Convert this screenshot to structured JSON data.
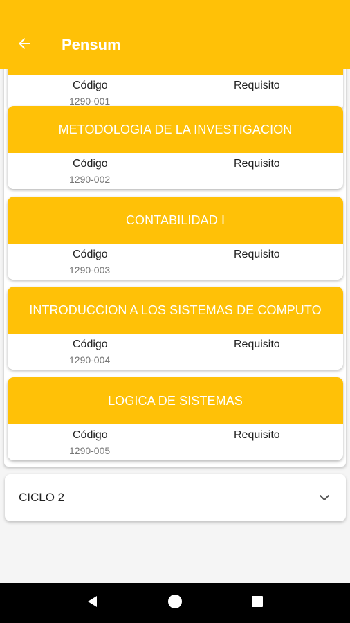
{
  "colors": {
    "accent": "#FFC107",
    "nav_bg": "#000000",
    "page_bg": "#F5F5F5"
  },
  "app_bar": {
    "title": "Pensum",
    "back_icon": "arrow-left-icon"
  },
  "courses": [
    {
      "name": "",
      "code_label": "Código",
      "code": "1290-001",
      "req_label": "Requisito"
    },
    {
      "name": "METODOLOGIA DE LA INVESTIGACION",
      "code_label": "Código",
      "code": "1290-002",
      "req_label": "Requisito"
    },
    {
      "name": "CONTABILIDAD I",
      "code_label": "Código",
      "code": "1290-003",
      "req_label": "Requisito"
    },
    {
      "name": "INTRODUCCION A LOS SISTEMAS DE COMPUTO",
      "code_label": "Código",
      "code": "1290-004",
      "req_label": "Requisito"
    },
    {
      "name": "LOGICA DE SISTEMAS",
      "code_label": "Código",
      "code": "1290-005",
      "req_label": "Requisito"
    }
  ],
  "cycles": [
    {
      "label": "CICLO 2",
      "icon": "chevron-down-icon"
    }
  ],
  "nav_bar": {
    "back": "nav-back-icon",
    "home": "nav-home-icon",
    "recents": "nav-recents-icon"
  }
}
